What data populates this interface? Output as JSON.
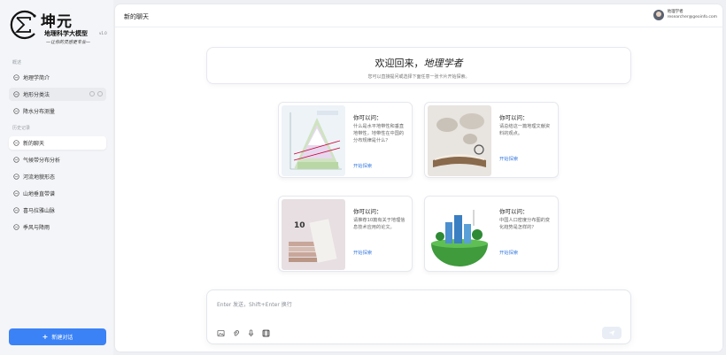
{
  "brand": {
    "name": "坤元",
    "subtitle": "地理科学大模型",
    "version": "v1.0",
    "slogan": "—让你的灵感更专业—"
  },
  "sidebar": {
    "section_overview": "概述",
    "overview_items": [
      {
        "label": "地理学简介"
      },
      {
        "label": "地形分类法"
      },
      {
        "label": "降水分布测量"
      }
    ],
    "section_history": "历史记录",
    "history_items": [
      {
        "label": "新的聊天"
      },
      {
        "label": "气候带分布分析"
      },
      {
        "label": "河流地貌形态"
      },
      {
        "label": "山地垂直带谱"
      },
      {
        "label": "喜马拉雅山脉"
      },
      {
        "label": "季风与降雨"
      }
    ],
    "new_chat_label": "新建对话"
  },
  "header": {
    "title": "新的聊天",
    "user_name": "地理学者",
    "user_email": "researcher@geoinfo.com"
  },
  "welcome": {
    "title_prefix": "欢迎回来，",
    "title_name": "地理学者",
    "subtitle": "您可以直接提问或选择下面任意一张卡片开始探索。"
  },
  "cards": [
    {
      "title": "你可以问：",
      "body": "什么是水平地带性和垂直地带性，地带性在中国的分布规律是什么？",
      "link": "开始探索"
    },
    {
      "title": "你可以问：",
      "body": "请总结这一篇地理文献资料的观点。",
      "link": "开始探索"
    },
    {
      "title": "你可以问：",
      "body": "请推荐10篇有关于地理信息技术应用的论文。",
      "link": "开始探索"
    },
    {
      "title": "你可以问：",
      "body": "中国人口密度分布图的变化趋势是怎样的？",
      "link": "开始探索"
    }
  ],
  "composer": {
    "placeholder": "Enter 发送，Shift+Enter 换行"
  },
  "colors": {
    "accent": "#3b82f6",
    "link": "#3b7de0",
    "sidebar_bg": "#f4f5f8"
  },
  "icons": [
    "chat-bubble-icon",
    "plus-icon",
    "image-icon",
    "paperclip-icon",
    "microphone-icon",
    "video-icon",
    "send-icon"
  ]
}
